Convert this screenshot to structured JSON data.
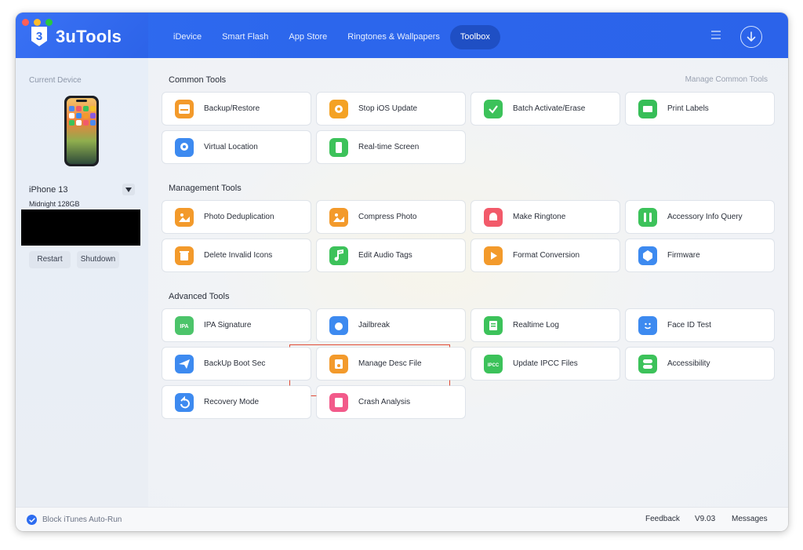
{
  "app": {
    "title": "3uTools"
  },
  "nav": [
    "iDevice",
    "Smart Flash",
    "App Store",
    "Ringtones & Wallpapers",
    "Toolbox"
  ],
  "nav_active": "Toolbox",
  "sidebar": {
    "title": "Current Device",
    "device_name": "iPhone 13",
    "device_sub": "Midnight 128GB",
    "restart_label": "Restart",
    "shutdown_label": "Shutdown"
  },
  "common": {
    "title": "Common Tools",
    "manage_label": "Manage Common Tools",
    "tools": [
      {
        "label": "Backup/Restore",
        "icon": "backup-icon",
        "color": "#f39a2b"
      },
      {
        "label": "Stop iOS Update",
        "icon": "gear-icon",
        "color": "#f4a224"
      },
      {
        "label": "Batch Activate/Erase",
        "icon": "shield-check-icon",
        "color": "#3cc25a"
      },
      {
        "label": "Print Labels",
        "icon": "printer-icon",
        "color": "#37be58"
      },
      {
        "label": "Virtual Location",
        "icon": "location-icon",
        "color": "#3d8af0"
      },
      {
        "label": "Real-time Screen",
        "icon": "screen-icon",
        "color": "#3cc25a"
      }
    ]
  },
  "management": {
    "title": "Management Tools",
    "tools": [
      {
        "label": "Photo Deduplication",
        "icon": "photo-icon",
        "color": "#f39a2b"
      },
      {
        "label": "Compress Photo",
        "icon": "photo-compress-icon",
        "color": "#f39a2b"
      },
      {
        "label": "Make Ringtone",
        "icon": "bell-icon",
        "color": "#f25a6a"
      },
      {
        "label": "Accessory Info Query",
        "icon": "airpods-icon",
        "color": "#3cc25a"
      },
      {
        "label": "Delete Invalid Icons",
        "icon": "trash-icon",
        "color": "#f39a2b"
      },
      {
        "label": "Edit  Audio Tags",
        "icon": "music-icon",
        "color": "#3cc25a"
      },
      {
        "label": "Format Conversion",
        "icon": "play-icon",
        "color": "#f39a2b"
      },
      {
        "label": "Firmware",
        "icon": "firmware-icon",
        "color": "#3d8af0"
      }
    ]
  },
  "advanced": {
    "title": "Advanced Tools",
    "tools": [
      {
        "label": "IPA Signature",
        "icon": "ipa-icon",
        "color": "#4cc46a",
        "badge": "IPA"
      },
      {
        "label": "Jailbreak",
        "icon": "apple-icon",
        "color": "#3d8af0"
      },
      {
        "label": "Realtime Log",
        "icon": "log-icon",
        "color": "#3cc25a"
      },
      {
        "label": "Face ID Test",
        "icon": "faceid-icon",
        "color": "#3d8af0"
      },
      {
        "label": "BackUp Boot Sec",
        "icon": "send-icon",
        "color": "#3d8af0"
      },
      {
        "label": "Manage Desc File",
        "icon": "file-icon",
        "color": "#f39a2b"
      },
      {
        "label": "Update IPCC Files",
        "icon": "ipcc-icon",
        "color": "#3cc25a",
        "badge": "IPCC"
      },
      {
        "label": "Accessibility",
        "icon": "toggle-icon",
        "color": "#3cc25a"
      },
      {
        "label": "Recovery Mode",
        "icon": "recovery-icon",
        "color": "#3d8af0"
      },
      {
        "label": "Crash Analysis",
        "icon": "crash-icon",
        "color": "#f25a8a"
      }
    ]
  },
  "footer": {
    "block_itunes": "Block iTunes Auto-Run",
    "feedback": "Feedback",
    "version": "V9.03",
    "messages": "Messages"
  }
}
